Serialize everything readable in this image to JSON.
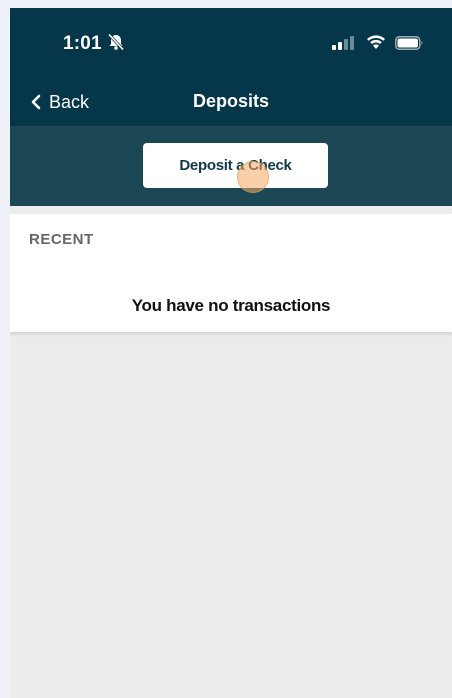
{
  "status_bar": {
    "time": "1:01",
    "icons": [
      "bell-muted-icon",
      "cellular-signal-icon",
      "wifi-icon",
      "battery-icon"
    ]
  },
  "nav": {
    "back_label": "Back",
    "title": "Deposits"
  },
  "actions": {
    "deposit_check_label": "Deposit a Check"
  },
  "recent": {
    "heading": "RECENT",
    "empty_message": "You have no transactions"
  },
  "colors": {
    "header_bg": "#05364a",
    "action_bar_bg": "#1b4854",
    "content_bg": "#ececec",
    "button_text": "#12384a"
  }
}
